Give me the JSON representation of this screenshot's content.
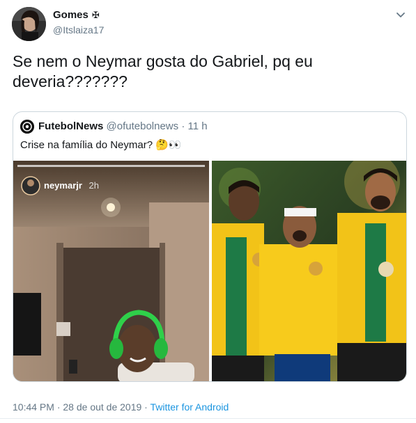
{
  "author": {
    "display_name": "Gomes",
    "badge_glyph": "✠",
    "handle": "@Itslaiza17"
  },
  "tweet": {
    "text": "Se nem o Neymar gosta do Gabriel, pq eu deveria???????"
  },
  "quoted": {
    "name": "FutebolNews",
    "handle": "@ofutebolnews",
    "separator": "·",
    "time": "11 h",
    "text": "Crise na família do Neymar? 🤔👀",
    "story": {
      "username": "neymarjr",
      "time": "2h"
    }
  },
  "footer": {
    "time": "10:44 PM",
    "separator1": "·",
    "date": "28 de out de 2019",
    "separator2": "·",
    "source": "Twitter for Android"
  },
  "colors": {
    "link": "#1b95e0",
    "secondary_text": "#657786",
    "border": "#ccd6dd",
    "jersey_yellow": "#f2c318",
    "headphones_green": "#2fd04a"
  },
  "icons": {
    "menu": "chevron-down-icon",
    "badge": "cross-icon"
  }
}
